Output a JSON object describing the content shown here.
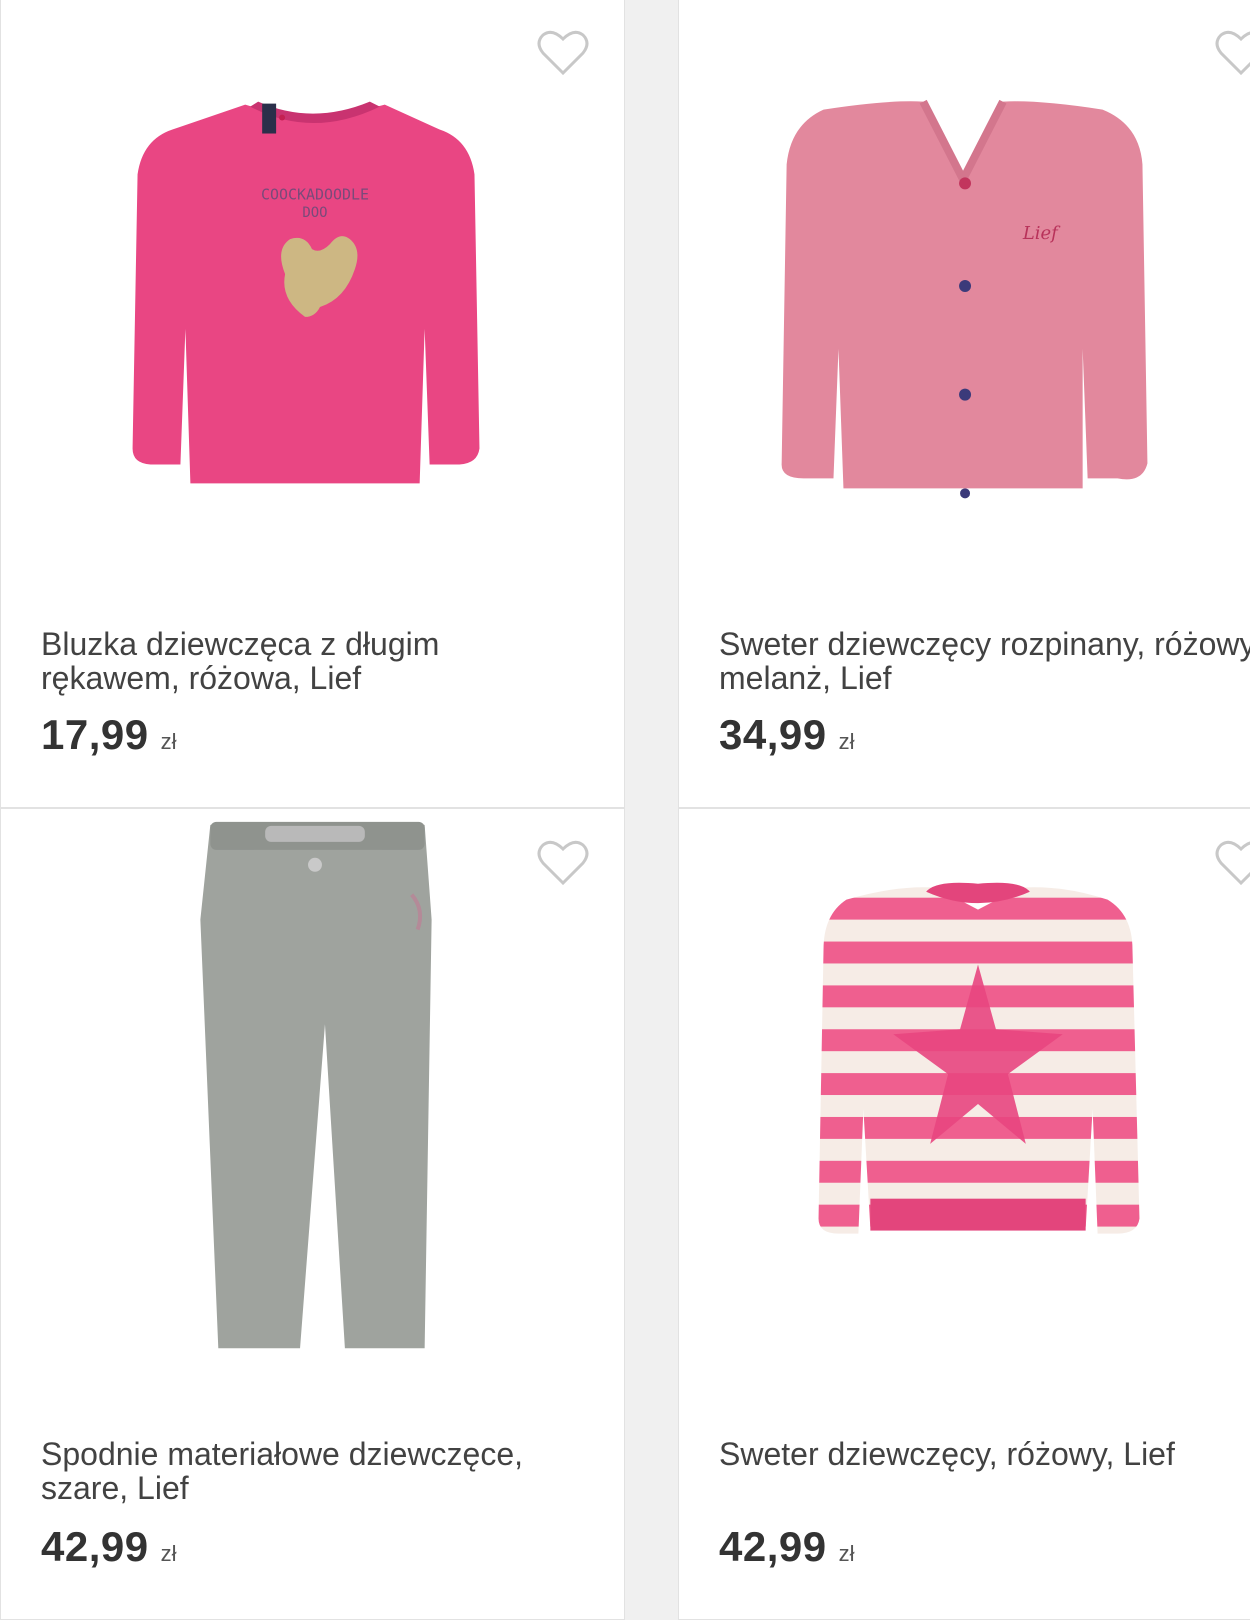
{
  "products": [
    {
      "title": "Bluzka dziewczęca z długim rękawem, różowa, Lief",
      "price": "17,99",
      "currency": "zł",
      "image": "pink-long-sleeve-shirt-rooster",
      "favorite_icon": "heart-outline-icon"
    },
    {
      "title": "Sweter dziewczęcy rozpinany, różowy melanż, Lief",
      "price": "34,99",
      "currency": "zł",
      "image": "pink-melange-cardigan",
      "favorite_icon": "heart-outline-icon"
    },
    {
      "title": "Spodnie materiałowe dziewczęce, szare, Lief",
      "price": "42,99",
      "currency": "zł",
      "image": "grey-trousers",
      "favorite_icon": "heart-outline-icon"
    },
    {
      "title": "Sweter dziewczęcy, różowy, Lief",
      "price": "42,99",
      "currency": "zł",
      "image": "pink-white-striped-sweater-star",
      "favorite_icon": "heart-outline-icon"
    }
  ],
  "colors": {
    "background": "#f0f0f0",
    "card": "#ffffff",
    "text": "#424242",
    "heart": "#c8c8c8"
  }
}
